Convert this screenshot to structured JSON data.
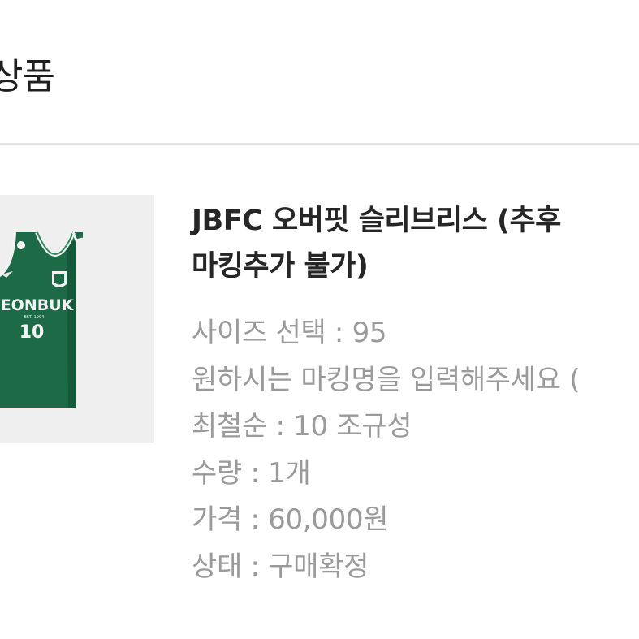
{
  "section": {
    "title": "상품"
  },
  "product": {
    "title_line1": "JBFC 오버핏 슬리브리스 (추후",
    "title_line2": "마킹추가 불가)",
    "image": {
      "icon": "jersey-image",
      "jersey_text": "JEONBUK",
      "jersey_sub": "EST. 1994",
      "jersey_number": "10"
    },
    "details": [
      "사이즈 선택 : 95",
      "원하시는 마킹명을 입력해주세요 (",
      "최철순 : 10 조규성",
      "수량 : 1개",
      "가격 : 60,000원",
      "상태 : 구매확정"
    ]
  },
  "colors": {
    "jersey_green": "#1d6a47",
    "trim_white": "#f2f2f2",
    "text_dark": "#262626",
    "text_gray": "#9a9a9a",
    "divider": "#e4e4e4"
  }
}
